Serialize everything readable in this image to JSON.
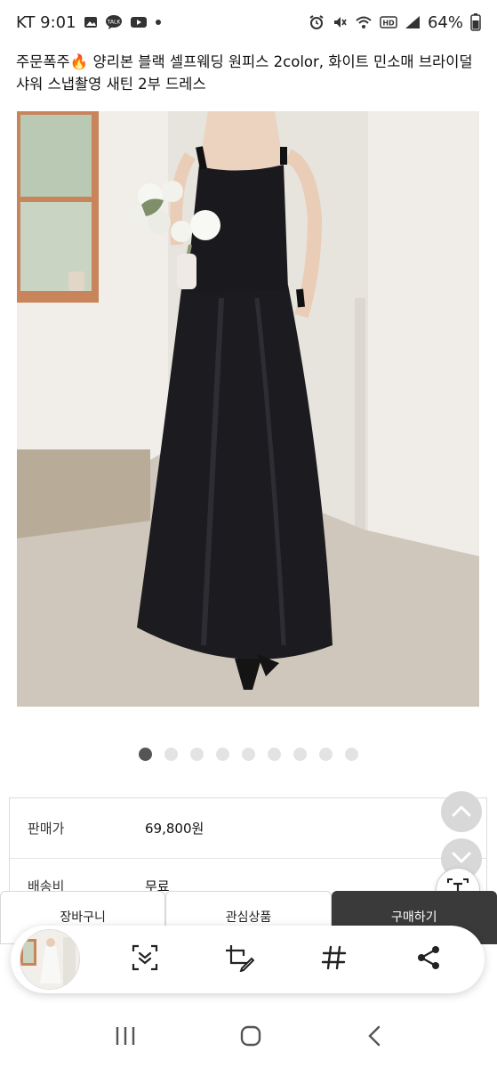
{
  "status_bar": {
    "carrier_time": "KT 9:01",
    "battery": "64%",
    "icons": [
      "gallery-icon",
      "talk-icon",
      "youtube-icon",
      "dot-icon",
      "alarm-icon",
      "mute-icon",
      "wifi-icon",
      "hd-icon",
      "signal-icon",
      "battery-icon"
    ]
  },
  "product": {
    "title": "주문폭주🔥 양리본 블랙 셀프웨딩 원피스 2color, 화이트 민소매 브라이덜샤워 스냅촬영 새틴 2부 드레스"
  },
  "carousel": {
    "total": 9,
    "active_index": 0
  },
  "info": {
    "rows": [
      {
        "label": "판매가",
        "value": "69,800원"
      },
      {
        "label": "배송비",
        "value": "무료"
      }
    ]
  },
  "actions": {
    "cart": "장바구니",
    "wishlist": "관심상품",
    "buy": "구매하기"
  },
  "capture_toolbar": {
    "tools": [
      "scroll-capture-icon",
      "crop-edit-icon",
      "hashtag-icon",
      "share-icon"
    ]
  },
  "nav": {
    "items": [
      "recent-apps-icon",
      "home-icon",
      "back-icon"
    ]
  },
  "colors": {
    "buy_bg": "#3a3a3a",
    "dot_active": "#555555",
    "dot_inactive": "#e3e3e3"
  }
}
